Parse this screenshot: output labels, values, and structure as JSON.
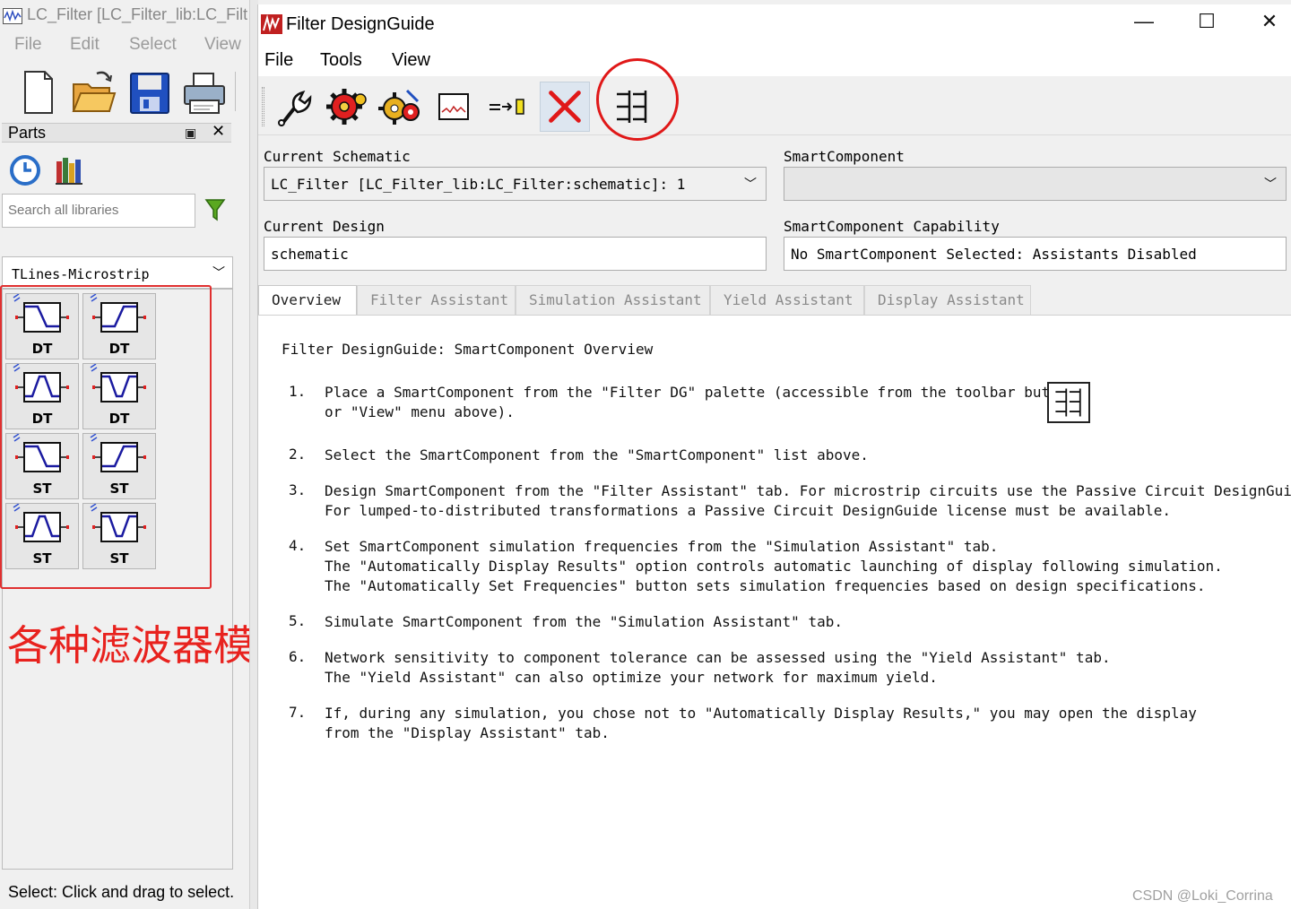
{
  "background_window": {
    "title": "LC_Filter [LC_Filter_lib:LC_Filt",
    "menu": [
      "File",
      "Edit",
      "Select",
      "View"
    ],
    "parts_panel": {
      "title": "Parts",
      "search_placeholder": "Search all libraries",
      "library": "TLines-Microstrip",
      "tiles": [
        {
          "shape": "lowpass",
          "tag": "DT"
        },
        {
          "shape": "highpass",
          "tag": "DT"
        },
        {
          "shape": "bandpass",
          "tag": "DT"
        },
        {
          "shape": "bandstop",
          "tag": "DT"
        },
        {
          "shape": "lowpass",
          "tag": "ST"
        },
        {
          "shape": "highpass",
          "tag": "ST"
        },
        {
          "shape": "bandpass",
          "tag": "ST"
        },
        {
          "shape": "bandstop",
          "tag": "ST"
        }
      ]
    },
    "annotation": "各种滤波器模型",
    "status": "Select: Click and drag to select."
  },
  "dialog": {
    "title": "Filter DesignGuide",
    "menu": {
      "file": "File",
      "tools": "Tools",
      "view": "View"
    },
    "toolbar_icons": [
      "wrench-icon",
      "gear-red-icon",
      "gear-multi-icon",
      "plot-icon",
      "connector-icon",
      "delete-icon",
      "palette-icon"
    ],
    "current_schematic_label": "Current Schematic",
    "current_schematic_value": "LC_Filter [LC_Filter_lib:LC_Filter:schematic]: 1",
    "smart_component_label": "SmartComponent",
    "smart_component_value": "",
    "current_design_label": "Current Design",
    "current_design_value": "schematic",
    "capability_label": "SmartComponent Capability",
    "capability_value": "No SmartComponent Selected: Assistants Disabled",
    "tabs": [
      "Overview",
      "Filter Assistant",
      "Simulation Assistant",
      "Yield Assistant",
      "Display Assistant"
    ],
    "overview": {
      "heading": "Filter DesignGuide: SmartComponent Overview",
      "items": [
        {
          "num": "1.",
          "lines": [
            "Place a SmartComponent from the \"Filter DG\" palette (accessible from the toolbar button",
            "or \"View\" menu above)."
          ]
        },
        {
          "num": "2.",
          "lines": [
            "Select the SmartComponent from the \"SmartComponent\" list above."
          ]
        },
        {
          "num": "3.",
          "lines": [
            "Design SmartComponent from the \"Filter Assistant\" tab. For microstrip circuits use the Passive Circuit DesignGuide.",
            "For lumped-to-distributed transformations a Passive Circuit DesignGuide license must be available."
          ]
        },
        {
          "num": "4.",
          "lines": [
            "Set SmartComponent simulation frequencies from the \"Simulation Assistant\" tab.",
            "The \"Automatically Display Results\" option controls automatic launching of display following simulation.",
            "The \"Automatically Set Frequencies\" button sets simulation frequencies based on design specifications."
          ]
        },
        {
          "num": "5.",
          "lines": [
            "Simulate SmartComponent from the \"Simulation Assistant\" tab."
          ]
        },
        {
          "num": "6.",
          "lines": [
            "Network sensitivity to component tolerance can be assessed using the \"Yield Assistant\" tab.",
            "The \"Yield Assistant\" can also optimize your network for maximum yield."
          ]
        },
        {
          "num": "7.",
          "lines": [
            "If, during any simulation, you chose not to \"Automatically Display Results,\" you may open the display",
            "from the \"Display Assistant\" tab."
          ]
        }
      ]
    }
  },
  "watermark": "CSDN @Loki_Corrina",
  "colors": {
    "annotation": "#e8221e",
    "filter_trace": "#1a1aa0"
  }
}
